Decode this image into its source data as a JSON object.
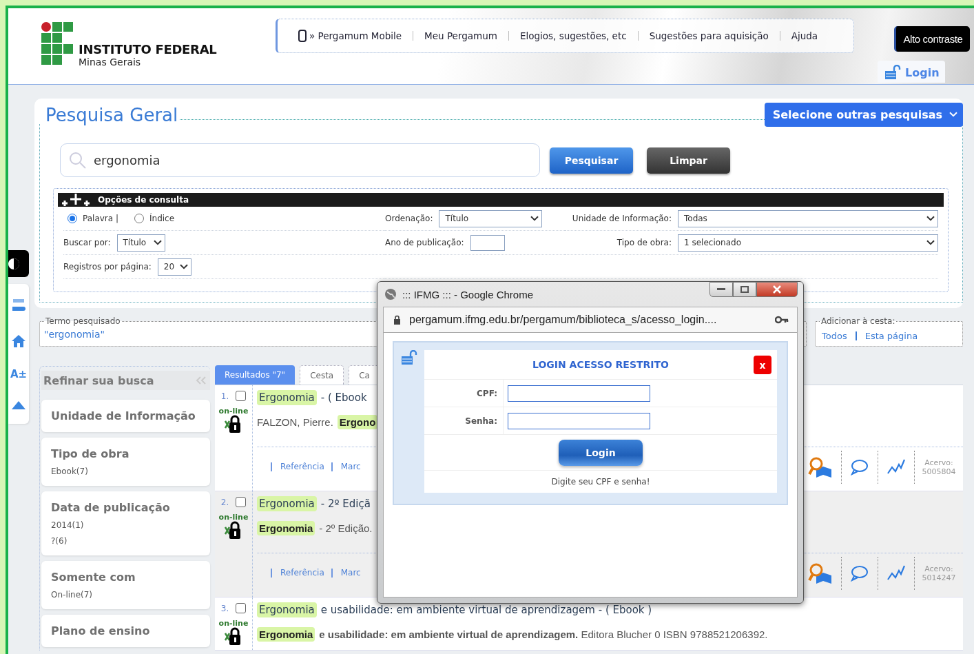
{
  "header": {
    "logo": {
      "name": "INSTITUTO FEDERAL",
      "subtitle": "Minas Gerais"
    },
    "nav": [
      {
        "label": "» Pergamum Mobile",
        "kind": "mobile"
      },
      {
        "label": "Meu Pergamum",
        "kind": "link"
      },
      {
        "label": "Elogios, sugestões, etc",
        "kind": "link"
      },
      {
        "label": "Sugestões para aquisição",
        "kind": "link"
      },
      {
        "label": "Ajuda",
        "kind": "link"
      }
    ],
    "contrast_button": "Alto contraste",
    "login_tab": "Login"
  },
  "accessibility_bar": {
    "font_size": "A±"
  },
  "search": {
    "title": "Pesquisa Geral",
    "other_searches": "Selecione outras pesquisas",
    "query": "ergonomia",
    "buttons": [
      {
        "label": "Pesquisar",
        "kind": "primary"
      },
      {
        "label": "Limpar",
        "kind": "secondary"
      }
    ]
  },
  "options": {
    "title": "Opções de consulta",
    "rows": [
      [
        {
          "kind": "radios",
          "options": [
            {
              "label": "Palavra |",
              "selected": true
            },
            {
              "label": "Índice",
              "selected": false
            }
          ]
        },
        {
          "kind": "select",
          "label": "Ordenação:",
          "value": "Título"
        },
        {
          "kind": "select",
          "label": "Unidade de Informação:",
          "value": "Todas"
        }
      ],
      [
        {
          "kind": "select",
          "label": "Buscar por:",
          "value": "Título"
        },
        {
          "kind": "input",
          "label": "Ano de publicação:"
        },
        {
          "kind": "select",
          "label": "Tipo de obra:",
          "value": "1 selecionado"
        }
      ],
      [
        {
          "kind": "select",
          "label": "Registros por página:",
          "value": "20"
        }
      ]
    ]
  },
  "searched_term": {
    "legend": "Termo pesquisado",
    "value": "\"ergonomia\""
  },
  "basket": {
    "legend": "Adicionar à cesta:",
    "links": [
      "Todos",
      "Esta página"
    ]
  },
  "refine": {
    "title": "Refinar sua busca",
    "groups": [
      {
        "title": "Unidade de Informação"
      },
      {
        "title": "Tipo de obra",
        "items": [
          "Ebook(7)"
        ]
      },
      {
        "title": "Data de publicação",
        "items": [
          "2014(1)",
          "?(6)"
        ]
      },
      {
        "title": "Somente com",
        "items": [
          "On-line(7)"
        ]
      },
      {
        "title": "Plano de ensino"
      }
    ]
  },
  "results": {
    "tabs": [
      {
        "label": "Resultados \"7\"",
        "selected": true
      },
      {
        "label": "Cesta",
        "selected": false
      },
      {
        "label": "Ca",
        "selected": false
      }
    ],
    "items": [
      {
        "number": "1.",
        "checked": false,
        "availability": "on-line",
        "title": [
          {
            "text": "Ergonomia",
            "highlight": true
          },
          {
            "text": "- ( Ebook",
            "highlight": false
          }
        ],
        "description": [
          {
            "text": "FALZON, Pierre.",
            "highlight": false
          },
          {
            "text": "Ergono",
            "highlight": true
          }
        ],
        "links": [
          "Referência",
          "Marc"
        ],
        "acervo_label": "Acervo:",
        "acervo": "5005804"
      },
      {
        "number": "2.",
        "checked": false,
        "availability": "on-line",
        "title": [
          {
            "text": "Ergonomia",
            "highlight": true
          },
          {
            "text": "- 2º Ediçã",
            "highlight": false
          }
        ],
        "description": [
          {
            "text": "Ergonomia",
            "highlight": true
          },
          {
            "text": "- 2º Edição.",
            "highlight": false
          }
        ],
        "links": [
          "Referência",
          "Marc"
        ],
        "acervo_label": "Acervo:",
        "acervo": "5014247"
      },
      {
        "number": "3.",
        "checked": false,
        "availability": "on-line",
        "title": [
          {
            "text": "Ergonomia",
            "highlight": true
          },
          {
            "text": "e usabilidade: em ambiente virtual de aprendizagem - ( Ebook )",
            "highlight": false
          }
        ],
        "description": [
          {
            "text": "Ergonomia",
            "highlight": true
          },
          {
            "text": "**e usabilidade: em ambiente virtual de aprendizagem.** Editora Blucher 0 ISBN 9788521206392.",
            "highlight": false
          }
        ]
      }
    ]
  },
  "popup": {
    "window_title": "::: IFMG ::: - Google Chrome",
    "url": "pergamum.ifmg.edu.br/pergamum/biblioteca_s/acesso_login....",
    "heading": "LOGIN ACESSO RESTRITO",
    "close": "x",
    "fields": [
      {
        "label": "CPF:"
      },
      {
        "label": "Senha:"
      }
    ],
    "submit": "Login",
    "hint": "Digite seu CPF e senha!"
  }
}
